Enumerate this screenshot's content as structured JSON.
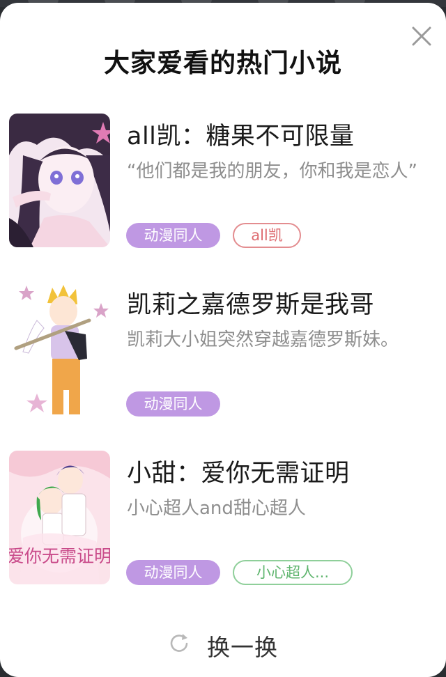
{
  "modal": {
    "title": "大家爱看的热门小说",
    "close_icon": "close-icon"
  },
  "novels": [
    {
      "title": "all凯：糖果不可限量",
      "description": "“他们都是我的朋友，你和我是恋人”",
      "tags": [
        "动漫同人",
        "all凯"
      ],
      "tag_colors": [
        "#bf98e3",
        "#e38c8f"
      ]
    },
    {
      "title": "凯莉之嘉德罗斯是我哥",
      "description": "凯莉大小姐突然穿越嘉德罗斯妹。",
      "tags": [
        "动漫同人"
      ],
      "tag_colors": [
        "#bf98e3"
      ]
    },
    {
      "title": "小甜：爱你无需证明",
      "description": "小心超人and甜心超人",
      "tags": [
        "动漫同人",
        "小心超人..."
      ],
      "tag_colors": [
        "#bf98e3",
        "#8fcf9a"
      ]
    }
  ],
  "covers": {
    "third_cover_text": "爱你无需证明"
  },
  "footer": {
    "refresh_label": "换一换",
    "refresh_icon": "refresh-icon"
  }
}
